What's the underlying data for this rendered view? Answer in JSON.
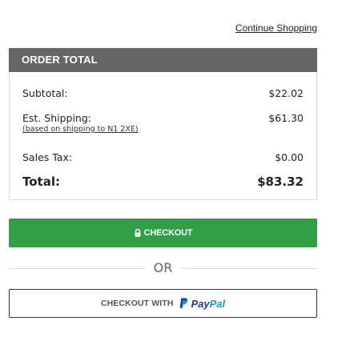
{
  "links": {
    "continue_shopping": "Continue Shopping"
  },
  "order_total": {
    "header": "ORDER TOTAL",
    "subtotal_label": "Subtotal:",
    "subtotal_value": "$22.02",
    "shipping_label": "Est. Shipping:",
    "shipping_value": "$61.30",
    "shipping_note": "(based on shipping to N1 2XE)",
    "tax_label": "Sales Tax:",
    "tax_value": "$0.00",
    "total_label": "Total:",
    "total_value": "$83.32"
  },
  "checkout": {
    "label": "CHECKOUT",
    "icon": "lock-icon"
  },
  "divider": {
    "or_text": "OR"
  },
  "paypal": {
    "prefix": "CHECKOUT WITH",
    "brand_pay": "Pay",
    "brand_pal": "Pal",
    "icon": "paypal-icon"
  },
  "colors": {
    "header_bg": "#666666",
    "checkout_green": "#2f9e44",
    "paypal_dark_blue": "#253b80",
    "paypal_light_blue": "#179bd7"
  }
}
